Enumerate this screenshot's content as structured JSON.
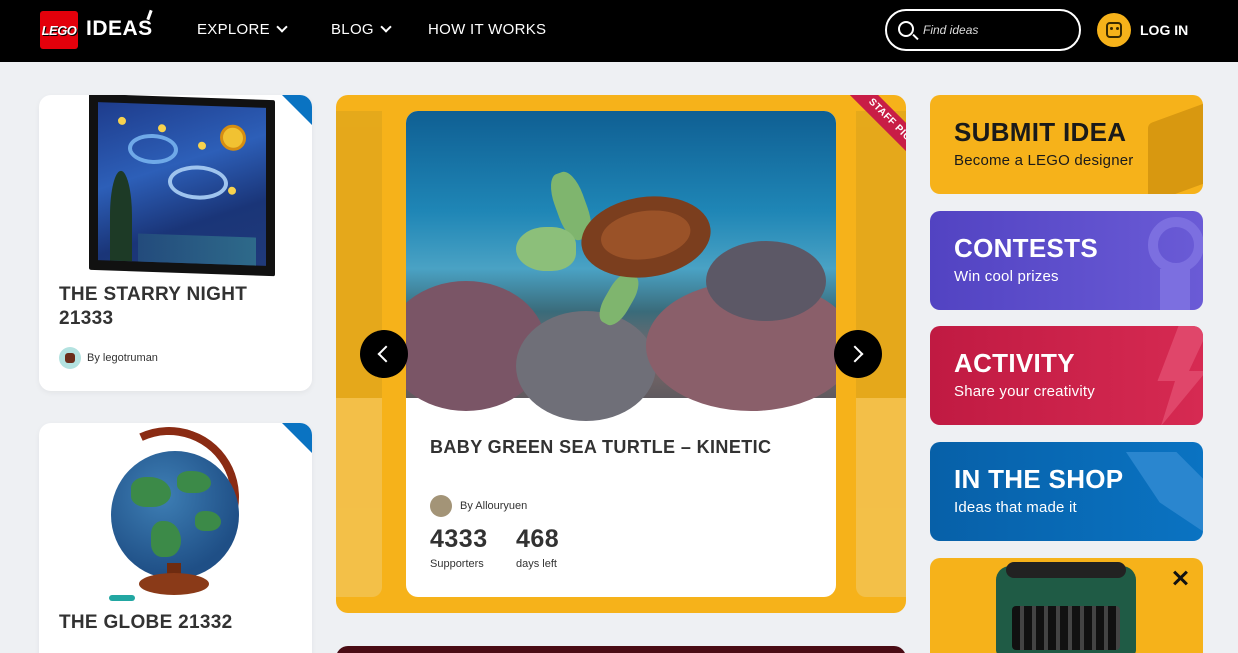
{
  "header": {
    "logo_brand": "LEGO",
    "logo_product": "IDEAS",
    "nav": [
      {
        "label": "EXPLORE",
        "has_dropdown": true
      },
      {
        "label": "BLOG",
        "has_dropdown": true
      },
      {
        "label": "HOW IT WORKS",
        "has_dropdown": false
      }
    ],
    "search_placeholder": "Find ideas",
    "login_label": "LOG IN"
  },
  "left_cards": [
    {
      "title": "THE STARRY NIGHT 21333",
      "author": "By legotruman",
      "badge_icon": "lego-ideas-badge-icon"
    },
    {
      "title": "THE GLOBE 21332",
      "badge_icon": "lego-ideas-badge-icon"
    }
  ],
  "featured": {
    "ribbon": "STAFF PICK",
    "title": "BABY GREEN SEA TURTLE – KINETIC",
    "author": "By Allouryuen",
    "supporters_value": "4333",
    "supporters_label": "Supporters",
    "days_value": "468",
    "days_label": "days left"
  },
  "promos": [
    {
      "title": "SUBMIT IDEA",
      "subtitle": "Become a LEGO designer",
      "color": "#f6b21a"
    },
    {
      "title": "CONTESTS",
      "subtitle": "Win cool prizes",
      "color": "#5b4bc4"
    },
    {
      "title": "ACTIVITY",
      "subtitle": "Share your creativity",
      "color": "#c41d46"
    },
    {
      "title": "IN THE SHOP",
      "subtitle": "Ideas that made it",
      "color": "#0a66ae"
    }
  ],
  "colors": {
    "accent_yellow": "#f6b21a",
    "lego_red": "#e3000b",
    "badge_blue": "#0a73c2"
  }
}
